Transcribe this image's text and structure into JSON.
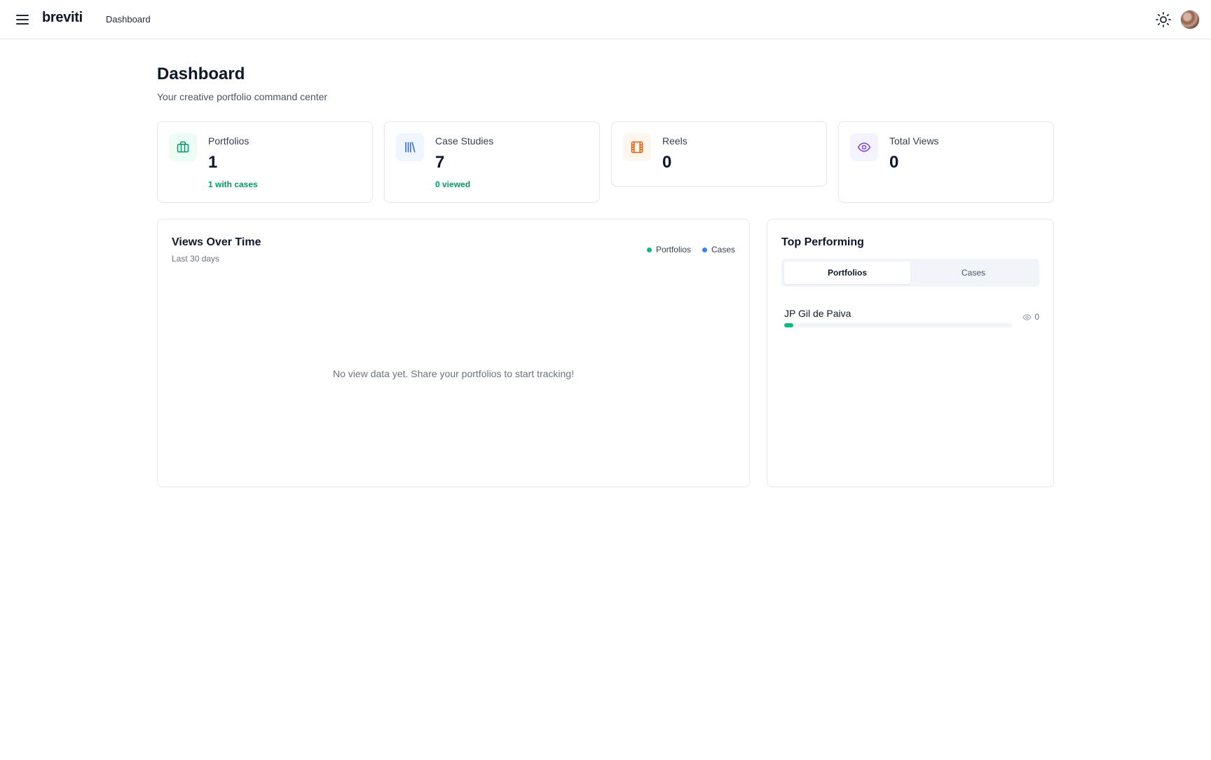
{
  "app": {
    "brand": "breviti",
    "breadcrumb": "Dashboard"
  },
  "header": {
    "title": "Dashboard",
    "subtitle": "Your creative portfolio command center"
  },
  "stats": [
    {
      "label": "Portfolios",
      "value": "1",
      "sub": "1 with cases",
      "icon": "briefcase-icon",
      "color": "#059669",
      "bg": "#ecfdf5"
    },
    {
      "label": "Case Studies",
      "value": "7",
      "sub": "0 viewed",
      "icon": "library-icon",
      "color": "#2563eb",
      "bg": "#eff6ff"
    },
    {
      "label": "Reels",
      "value": "0",
      "sub": "",
      "icon": "film-icon",
      "color": "#ea580c",
      "bg": "#fff7ed"
    },
    {
      "label": "Total Views",
      "value": "0",
      "sub": "",
      "icon": "eye-icon",
      "color": "#7c3aed",
      "bg": "#f5f3ff"
    }
  ],
  "views_chart": {
    "title": "Views Over Time",
    "subtitle": "Last 30 days",
    "legend": [
      {
        "label": "Portfolios",
        "color": "#10b981"
      },
      {
        "label": "Cases",
        "color": "#3b82f6"
      }
    ],
    "empty_message": "No view data yet. Share your portfolios to start tracking!"
  },
  "top_performing": {
    "title": "Top Performing",
    "tabs": [
      {
        "label": "Portfolios",
        "active": true
      },
      {
        "label": "Cases",
        "active": false
      }
    ],
    "items": [
      {
        "name": "JP Gil de Paiva",
        "views": "0",
        "progress_fraction": 0.04
      }
    ]
  }
}
